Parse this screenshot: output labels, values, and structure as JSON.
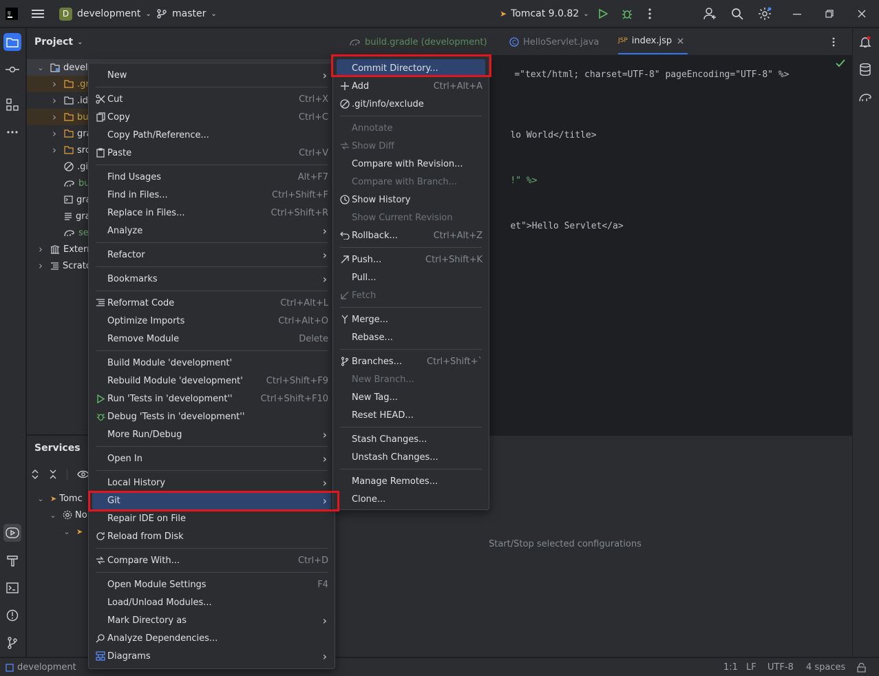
{
  "titlebar": {
    "project_badge": "D",
    "project_name": "development",
    "branch": "master",
    "run_config": "Tomcat 9.0.82"
  },
  "project_panel": {
    "title": "Project",
    "tree": [
      {
        "label": "develo",
        "depth": 0,
        "expanded": true
      },
      {
        "label": ".gra",
        "depth": 1
      },
      {
        "label": ".ide",
        "depth": 1
      },
      {
        "label": "buil",
        "depth": 1
      },
      {
        "label": "gra",
        "depth": 1
      },
      {
        "label": "src",
        "depth": 1
      },
      {
        "label": ".git",
        "depth": 1
      },
      {
        "label": "bui",
        "depth": 1
      },
      {
        "label": "gra",
        "depth": 1
      },
      {
        "label": "gra",
        "depth": 1
      },
      {
        "label": "set",
        "depth": 1
      },
      {
        "label": "Extern",
        "depth": 0
      },
      {
        "label": "Scratc",
        "depth": 0
      }
    ]
  },
  "services_panel": {
    "title": "Services",
    "tree": [
      {
        "label": "Tomc"
      },
      {
        "label": "No"
      }
    ],
    "empty_hint": "Start/Stop selected configurations"
  },
  "editor": {
    "tabs": [
      {
        "label": "build.gradle (development)",
        "active": false
      },
      {
        "label": "HelloServlet.java",
        "active": false
      },
      {
        "label": "index.jsp",
        "active": true
      }
    ],
    "lines": [
      {
        "text": "=\"text/html; charset=UTF-8\" pageEncoding=\"UTF-8\" %>"
      },
      {
        "text": "lo World</title>"
      },
      {
        "text": "!\" %>"
      },
      {
        "text": "et\">Hello Servlet</a>"
      }
    ]
  },
  "context_menu": {
    "items": [
      {
        "label": "New",
        "submenu": true
      },
      {
        "sep": true
      },
      {
        "label": "Cut",
        "shortcut": "Ctrl+X",
        "icon": "scissors-icon"
      },
      {
        "label": "Copy",
        "shortcut": "Ctrl+C",
        "icon": "copy-icon"
      },
      {
        "label": "Copy Path/Reference..."
      },
      {
        "label": "Paste",
        "shortcut": "Ctrl+V",
        "icon": "paste-icon"
      },
      {
        "sep": true
      },
      {
        "label": "Find Usages",
        "shortcut": "Alt+F7"
      },
      {
        "label": "Find in Files...",
        "shortcut": "Ctrl+Shift+F"
      },
      {
        "label": "Replace in Files...",
        "shortcut": "Ctrl+Shift+R"
      },
      {
        "label": "Analyze",
        "submenu": true
      },
      {
        "sep": true
      },
      {
        "label": "Refactor",
        "submenu": true
      },
      {
        "sep": true
      },
      {
        "label": "Bookmarks",
        "submenu": true
      },
      {
        "sep": true
      },
      {
        "label": "Reformat Code",
        "shortcut": "Ctrl+Alt+L",
        "icon": "reformat-icon"
      },
      {
        "label": "Optimize Imports",
        "shortcut": "Ctrl+Alt+O"
      },
      {
        "label": "Remove Module",
        "shortcut": "Delete"
      },
      {
        "sep": true
      },
      {
        "label": "Build Module 'development'"
      },
      {
        "label": "Rebuild Module 'development'",
        "shortcut": "Ctrl+Shift+F9"
      },
      {
        "label": "Run 'Tests in 'development''",
        "shortcut": "Ctrl+Shift+F10",
        "icon": "run-icon"
      },
      {
        "label": "Debug 'Tests in 'development''",
        "icon": "debug-icon"
      },
      {
        "label": "More Run/Debug",
        "submenu": true
      },
      {
        "sep": true
      },
      {
        "label": "Open In",
        "submenu": true
      },
      {
        "sep": true
      },
      {
        "label": "Local History",
        "submenu": true
      },
      {
        "label": "Git",
        "submenu": true,
        "selected": true
      },
      {
        "label": "Repair IDE on File"
      },
      {
        "label": "Reload from Disk",
        "icon": "reload-icon"
      },
      {
        "sep": true
      },
      {
        "label": "Compare With...",
        "shortcut": "Ctrl+D",
        "icon": "compare-icon"
      },
      {
        "sep": true
      },
      {
        "label": "Open Module Settings",
        "shortcut": "F4"
      },
      {
        "label": "Load/Unload Modules..."
      },
      {
        "label": "Mark Directory as",
        "submenu": true
      },
      {
        "label": "Analyze Dependencies...",
        "icon": "analyze-deps-icon"
      },
      {
        "label": "Diagrams",
        "submenu": true,
        "icon": "diagram-icon"
      }
    ]
  },
  "git_submenu": {
    "items": [
      {
        "label": "Commit Directory...",
        "selected": true
      },
      {
        "label": "Add",
        "shortcut": "Ctrl+Alt+A",
        "icon": "plus-icon"
      },
      {
        "label": ".git/info/exclude",
        "icon": "ignore-icon"
      },
      {
        "sep": true
      },
      {
        "label": "Annotate",
        "disabled": true
      },
      {
        "label": "Show Diff",
        "disabled": true,
        "icon": "diff-icon"
      },
      {
        "label": "Compare with Revision..."
      },
      {
        "label": "Compare with Branch...",
        "disabled": true
      },
      {
        "label": "Show History",
        "icon": "history-icon"
      },
      {
        "label": "Show Current Revision",
        "disabled": true
      },
      {
        "label": "Rollback...",
        "shortcut": "Ctrl+Alt+Z",
        "icon": "rollback-icon"
      },
      {
        "sep": true
      },
      {
        "label": "Push...",
        "shortcut": "Ctrl+Shift+K",
        "icon": "push-icon"
      },
      {
        "label": "Pull..."
      },
      {
        "label": "Fetch",
        "disabled": true,
        "icon": "fetch-icon"
      },
      {
        "sep": true
      },
      {
        "label": "Merge...",
        "icon": "merge-icon"
      },
      {
        "label": "Rebase..."
      },
      {
        "sep": true
      },
      {
        "label": "Branches...",
        "shortcut": "Ctrl+Shift+`",
        "icon": "branch-icon"
      },
      {
        "label": "New Branch...",
        "disabled": true
      },
      {
        "label": "New Tag..."
      },
      {
        "label": "Reset HEAD..."
      },
      {
        "sep": true
      },
      {
        "label": "Stash Changes..."
      },
      {
        "label": "Unstash Changes..."
      },
      {
        "sep": true
      },
      {
        "label": "Manage Remotes..."
      },
      {
        "label": "Clone..."
      }
    ]
  },
  "statusbar": {
    "project": "development",
    "position": "1:1",
    "line_sep": "LF",
    "encoding": "UTF-8",
    "indent": "4 spaces"
  },
  "colors": {
    "highlight_box": "#e3161d",
    "selection": "#2e436e",
    "accent_green": "#5fb865"
  }
}
